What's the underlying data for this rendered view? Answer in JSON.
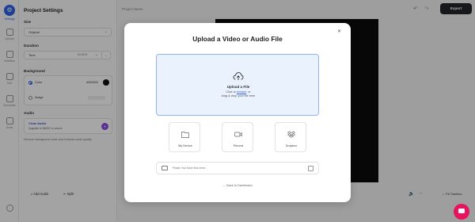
{
  "rail": {
    "items": [
      {
        "label": "Settings",
        "icon": "gear-icon"
      },
      {
        "label": "Upload",
        "icon": "upload-icon"
      },
      {
        "label": "Subtitles",
        "icon": "subtitles-icon"
      },
      {
        "label": "Text",
        "icon": "text-icon"
      },
      {
        "label": "Elements",
        "icon": "elements-icon"
      },
      {
        "label": "Draw",
        "icon": "pencil-icon"
      }
    ]
  },
  "settings": {
    "title": "Project Settings",
    "size_label": "Size",
    "size_value": "Original",
    "duration_label": "Duration",
    "duration_mode": "Time",
    "duration_value": "00:00:5",
    "background_label": "Background",
    "color_option": "Color",
    "color_value": "#000000",
    "image_option": "Image",
    "audio_label": "Audio",
    "clean_audio_title": "Clean Audio",
    "clean_audio_sub": "Upgrade to BASIC to unlock",
    "audio_note": "Remove background noise and enhance audio quality"
  },
  "topbar": {
    "project_name": "Project Name",
    "export_label": "Export"
  },
  "bottombar": {
    "add_audio": "Add Audio",
    "split": "Split",
    "fit_timeline": "Fit Timeline"
  },
  "modal": {
    "title": "Upload a Video or Audio File",
    "upload_title": "Upload a File",
    "click_to": "Click to",
    "browse": "browse",
    "or": ", or",
    "drag_text": "drag & drop your file here",
    "sources": [
      {
        "label": "My Device",
        "icon": "folder-icon"
      },
      {
        "label": "Record",
        "icon": "camera-icon"
      },
      {
        "label": "Dropbox",
        "icon": "dropbox-icon"
      }
    ],
    "youtube_placeholder": "Paste YouTube link here...",
    "back_label": "Back to Dashboard"
  },
  "colors": {
    "accent": "#2f62e8",
    "export_bg": "#23252c",
    "chat": "#e8135c",
    "dropzone_bg": "#eaf2fe"
  }
}
